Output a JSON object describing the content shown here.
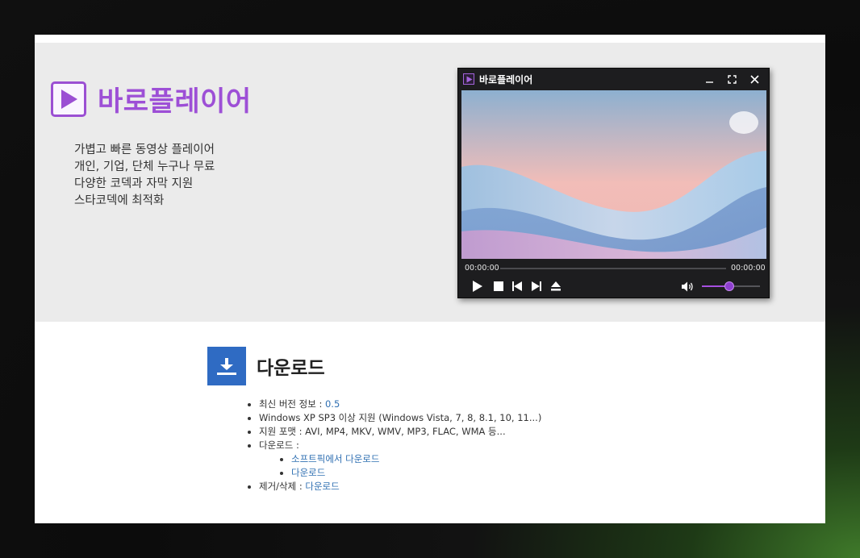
{
  "hero": {
    "app_name": "바로플레이어",
    "features": [
      "가볍고 빠른 동영상 플레이어",
      "개인, 기업, 단체 누구나 무료",
      "다양한 코덱과 자막 지원",
      "스타코덱에 최적화"
    ]
  },
  "player": {
    "title": "바로플레이어",
    "time_current": "00:00:00",
    "time_total": "00:00:00",
    "volume": 0.47,
    "icons": [
      "app-play-icon",
      "minimize-icon",
      "maximize-icon",
      "close-icon",
      "play-icon",
      "stop-icon",
      "previous-icon",
      "next-icon",
      "eject-icon",
      "volume-icon"
    ]
  },
  "download": {
    "title": "다운로드",
    "version_label": "최신 버전 정보 : ",
    "version_value": "0.5",
    "os_support": "Windows XP SP3 이상 지원 (Windows Vista, 7, 8, 8.1, 10, 11...)",
    "formats": "지원 포맷 : AVI, MP4, MKV, WMV, MP3, FLAC, WMA 등...",
    "download_label": "다운로드 :",
    "links": [
      "소프트픽에서 다운로드",
      "다운로드"
    ],
    "remove_label": "제거/삭제 : ",
    "remove_link": "다운로드"
  },
  "colors": {
    "brand_purple": "#9d4fd6",
    "download_blue": "#2f6bc3",
    "link_blue": "#2f6fb2"
  }
}
